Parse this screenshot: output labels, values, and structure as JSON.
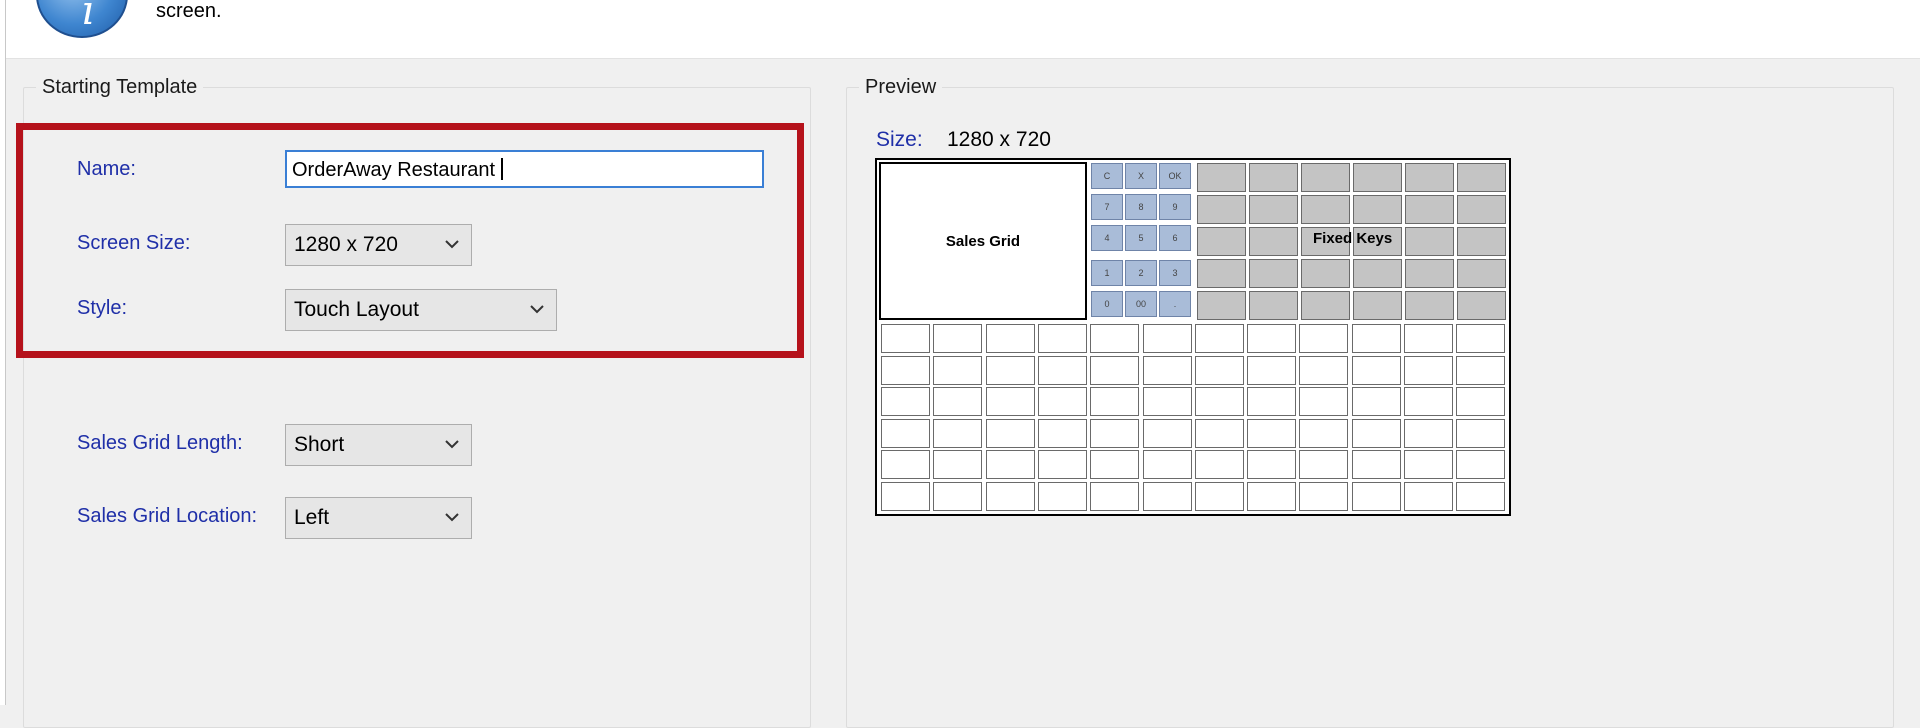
{
  "header": {
    "text": "screen."
  },
  "starting_template": {
    "legend": "Starting Template",
    "name_label": "Name:",
    "name_value": "OrderAway Restaurant",
    "screen_size_label": "Screen Size:",
    "screen_size_value": "1280 x 720",
    "style_label": "Style:",
    "style_value": "Touch Layout",
    "sales_grid_length_label": "Sales Grid Length:",
    "sales_grid_length_value": "Short",
    "sales_grid_location_label": "Sales Grid Location:",
    "sales_grid_location_value": "Left"
  },
  "preview": {
    "legend": "Preview",
    "size_label": "Size:",
    "size_value": "1280 x 720",
    "sales_grid_label": "Sales Grid",
    "fixed_keys_label": "Fixed Keys",
    "keypad_keys": [
      "C",
      "X",
      "OK",
      "7",
      "8",
      "9",
      "4",
      "5",
      "6",
      "1",
      "2",
      "3",
      "0",
      "00",
      "."
    ],
    "fixed_key_rows": 5,
    "fixed_key_cols": 6,
    "button_grid_rows": 6,
    "button_grid_cols": 12
  },
  "colors": {
    "label_blue": "#1f2fa8",
    "highlight_red": "#b5121b",
    "keypad_blue": "#a9bcd8",
    "fixed_key_gray": "#c4c4c4"
  }
}
